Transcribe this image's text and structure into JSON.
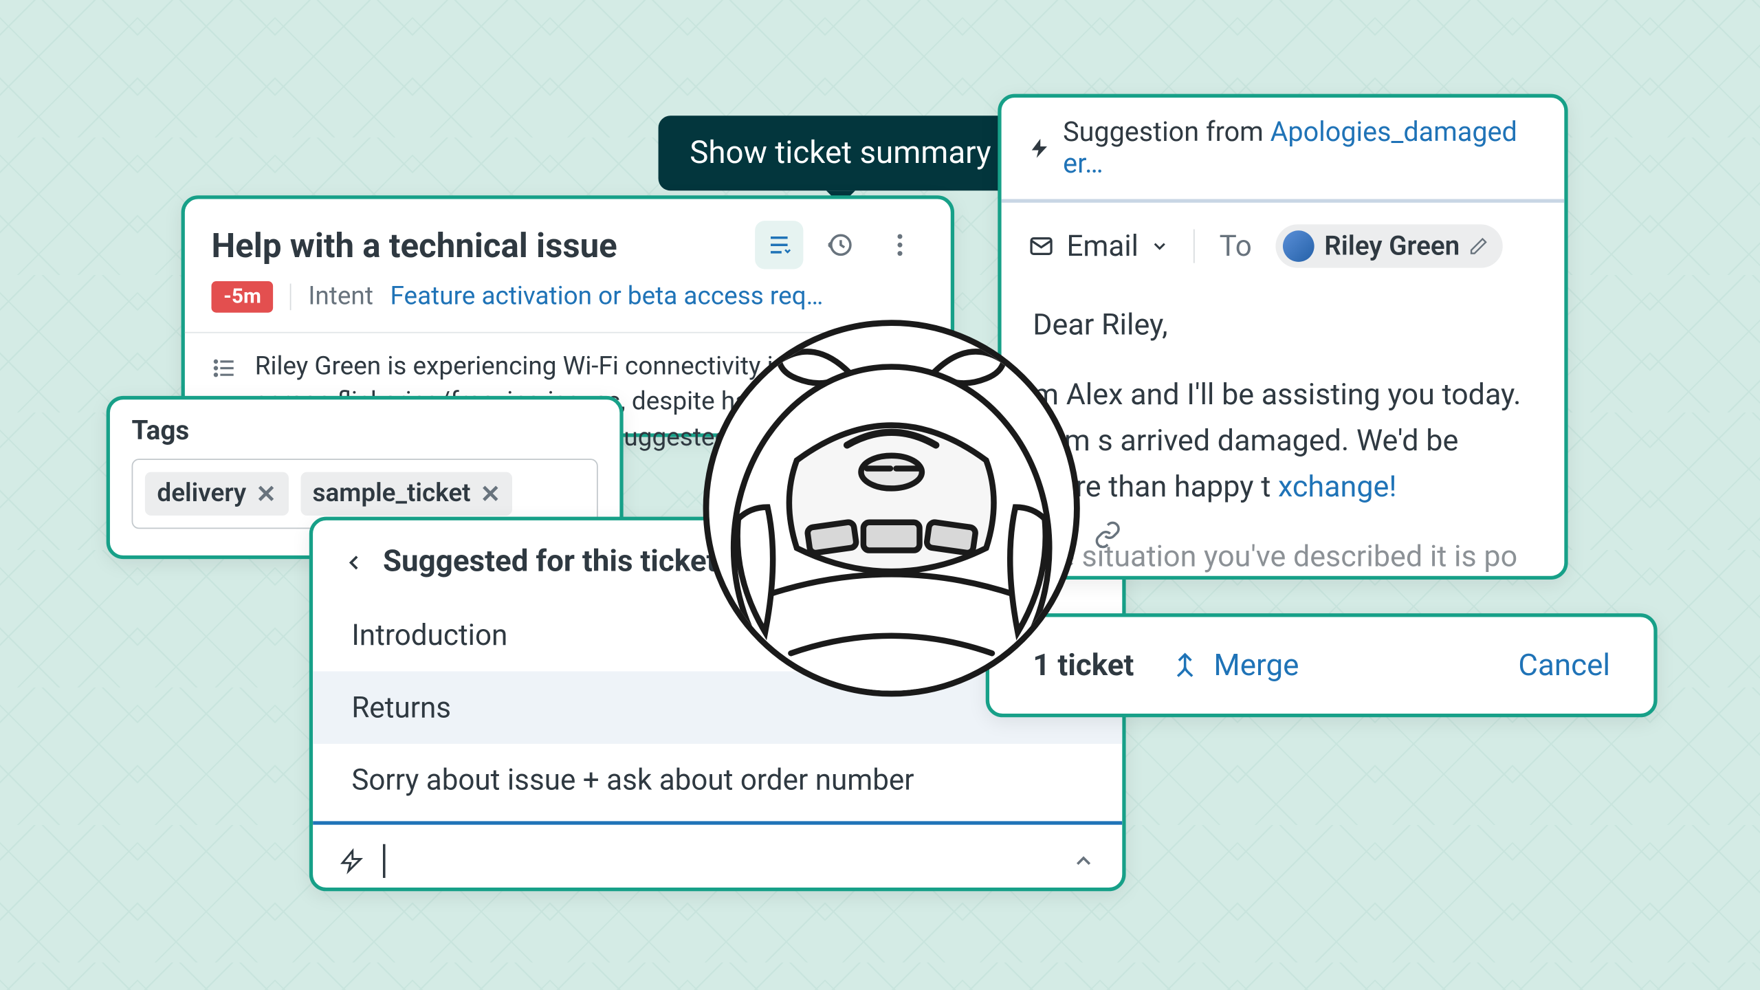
{
  "tooltip": {
    "text": "Show ticket summary"
  },
  "ticket": {
    "title": "Help with a technical issue",
    "badge": "-5m",
    "intent_label": "Intent",
    "intent_link": "Feature activation or beta access req…",
    "summary": "Riley Green is experiencing Wi-Fi connectivity issues and screen flickering/freezing issues, despite having already raised a support ticket. The bot suggested resetting their network, which di"
  },
  "tags": {
    "title": "Tags",
    "items": [
      {
        "label": "delivery"
      },
      {
        "label": "sample_ticket"
      }
    ]
  },
  "suggested": {
    "title": "Suggested for this ticket",
    "items": [
      {
        "label": "Introduction",
        "highlight": false
      },
      {
        "label": "Returns",
        "highlight": true
      },
      {
        "label": "Sorry about issue + ask about order number",
        "highlight": false
      }
    ]
  },
  "email": {
    "suggestion_prefix": "Suggestion from ",
    "suggestion_link": "Apologies_damaged er…",
    "channel": "Email",
    "to_label": "To",
    "recipient": "Riley Green",
    "greeting": "Dear Riley,",
    "body_line": "m Alex and I'll be assisting you today. I am s           arrived damaged. We'd be more than happy t",
    "body_link": "xchange!",
    "body_trail": "the situation you've described  it is po"
  },
  "mergebar": {
    "count": "1 ticket",
    "merge": "Merge",
    "cancel": "Cancel"
  }
}
